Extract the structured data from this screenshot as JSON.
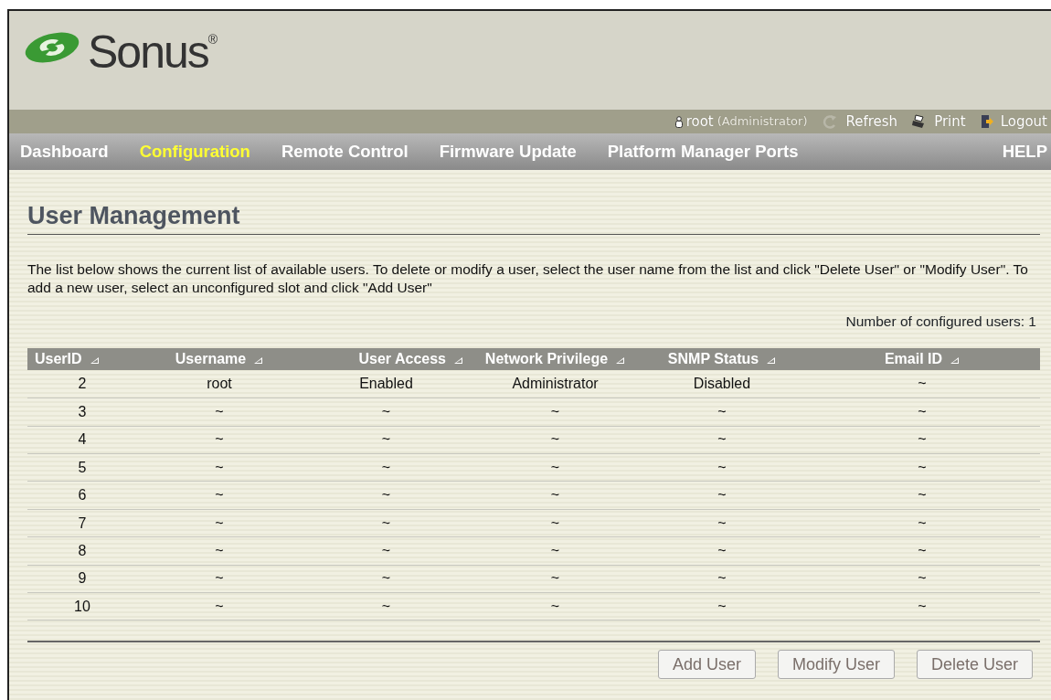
{
  "logo": {
    "text": "Sonus",
    "mark": "®"
  },
  "user_bar": {
    "user": "root",
    "role": "(Administrator)",
    "actions": [
      {
        "kind": "refresh",
        "label": "Refresh"
      },
      {
        "kind": "print",
        "label": "Print"
      },
      {
        "kind": "logout",
        "label": "Logout"
      }
    ]
  },
  "nav": {
    "items": [
      {
        "label": "Dashboard",
        "selected": false
      },
      {
        "label": "Configuration",
        "selected": true
      },
      {
        "label": "Remote Control",
        "selected": false
      },
      {
        "label": "Firmware Update",
        "selected": false
      },
      {
        "label": "Platform Manager Ports",
        "selected": false
      }
    ],
    "help": "HELP"
  },
  "page": {
    "title": "User Management",
    "description": "The list below shows the current list of available users. To delete or modify a user, select the user name from the list and click \"Delete User\" or \"Modify User\". To add a new user, select an unconfigured slot and click \"Add User\"",
    "count": "Number of configured users: 1"
  },
  "table": {
    "columns": [
      "UserID",
      "Username",
      "User Access",
      "Network Privilege",
      "SNMP Status",
      "Email ID"
    ],
    "rows": [
      [
        "2",
        "root",
        "Enabled",
        "Administrator",
        "Disabled",
        "~"
      ],
      [
        "3",
        "~",
        "~",
        "~",
        "~",
        "~"
      ],
      [
        "4",
        "~",
        "~",
        "~",
        "~",
        "~"
      ],
      [
        "5",
        "~",
        "~",
        "~",
        "~",
        "~"
      ],
      [
        "6",
        "~",
        "~",
        "~",
        "~",
        "~"
      ],
      [
        "7",
        "~",
        "~",
        "~",
        "~",
        "~"
      ],
      [
        "8",
        "~",
        "~",
        "~",
        "~",
        "~"
      ],
      [
        "9",
        "~",
        "~",
        "~",
        "~",
        "~"
      ],
      [
        "10",
        "~",
        "~",
        "~",
        "~",
        "~"
      ]
    ]
  },
  "buttons": [
    {
      "label": "Add User",
      "disabled": true
    },
    {
      "label": "Modify User",
      "disabled": true
    },
    {
      "label": "Delete User",
      "disabled": true
    }
  ]
}
